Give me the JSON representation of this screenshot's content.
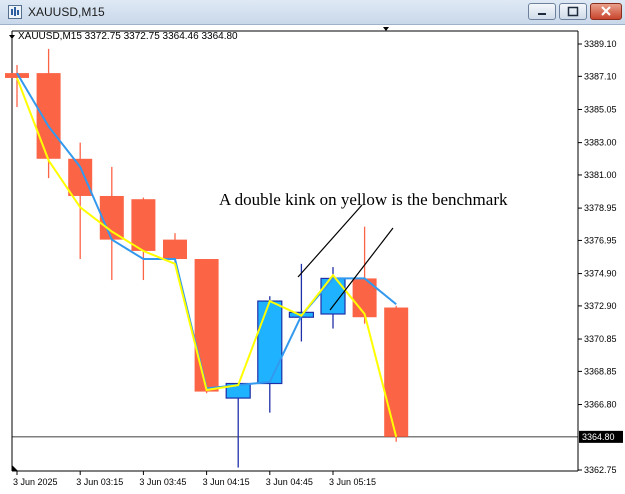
{
  "window": {
    "title": "XAUUSD,M15"
  },
  "chart_header": {
    "info_line": "XAUUSD,M15  3372.75 3372.75 3364.46 3364.80"
  },
  "annotation": {
    "text": "A double kink on yellow is the benchmark"
  },
  "colors": {
    "bull_fill": "#1fb3ff",
    "bull_border": "#1f2fa8",
    "bear_fill": "#fc6446",
    "blue_line": "#3399ee",
    "yellow_line": "#ffff00",
    "price_tag": "#000000"
  },
  "chart_data": {
    "type": "candlestick",
    "symbol": "XAUUSD",
    "timeframe": "M15",
    "ylim": [
      3362.75,
      3389.1
    ],
    "y_ticks": [
      "3389.10",
      "3387.10",
      "3385.05",
      "3383.00",
      "3381.00",
      "3378.95",
      "3376.95",
      "3374.90",
      "3372.90",
      "3370.85",
      "3368.85",
      "3366.80",
      "3362.75"
    ],
    "x_ticks": [
      "3 Jun 2025",
      "3 Jun 03:15",
      "3 Jun 03:45",
      "3 Jun 04:15",
      "3 Jun 04:45",
      "3 Jun 05:15"
    ],
    "current_price": "3364.80",
    "candles": [
      {
        "o": 3387.3,
        "h": 3387.8,
        "l": 3385.2,
        "c": 3387.0
      },
      {
        "o": 3387.3,
        "h": 3388.8,
        "l": 3380.8,
        "c": 3382.0
      },
      {
        "o": 3382.0,
        "h": 3383.0,
        "l": 3375.8,
        "c": 3379.7
      },
      {
        "o": 3379.7,
        "h": 3381.5,
        "l": 3374.5,
        "c": 3377.0
      },
      {
        "o": 3379.5,
        "h": 3379.6,
        "l": 3374.5,
        "c": 3376.3
      },
      {
        "o": 3377.0,
        "h": 3377.4,
        "l": 3375.6,
        "c": 3375.8
      },
      {
        "o": 3375.8,
        "h": 3375.8,
        "l": 3367.5,
        "c": 3367.6
      },
      {
        "o": 3367.2,
        "h": 3367.8,
        "l": 3362.9,
        "c": 3368.1
      },
      {
        "o": 3368.1,
        "h": 3373.5,
        "l": 3366.3,
        "c": 3373.2
      },
      {
        "o": 3372.2,
        "h": 3375.5,
        "l": 3370.7,
        "c": 3372.5
      },
      {
        "o": 3372.4,
        "h": 3375.3,
        "l": 3371.5,
        "c": 3374.6
      },
      {
        "o": 3374.6,
        "h": 3377.8,
        "l": 3371.8,
        "c": 3372.2
      },
      {
        "o": 3372.8,
        "h": 3372.9,
        "l": 3364.5,
        "c": 3364.8
      }
    ],
    "series": [
      {
        "values": [
          3387.3,
          3384.0,
          3381.5,
          3377.0,
          3375.8,
          3375.8,
          3367.8,
          3368.0,
          3368.2,
          3372.3,
          3374.6,
          3374.6,
          3373.0
        ]
      },
      {
        "values": [
          3387.0,
          3381.9,
          3379.0,
          3377.5,
          3376.3,
          3375.5,
          3367.7,
          3368.0,
          3373.2,
          3372.3,
          3374.8,
          3372.4,
          3364.8
        ]
      }
    ]
  }
}
